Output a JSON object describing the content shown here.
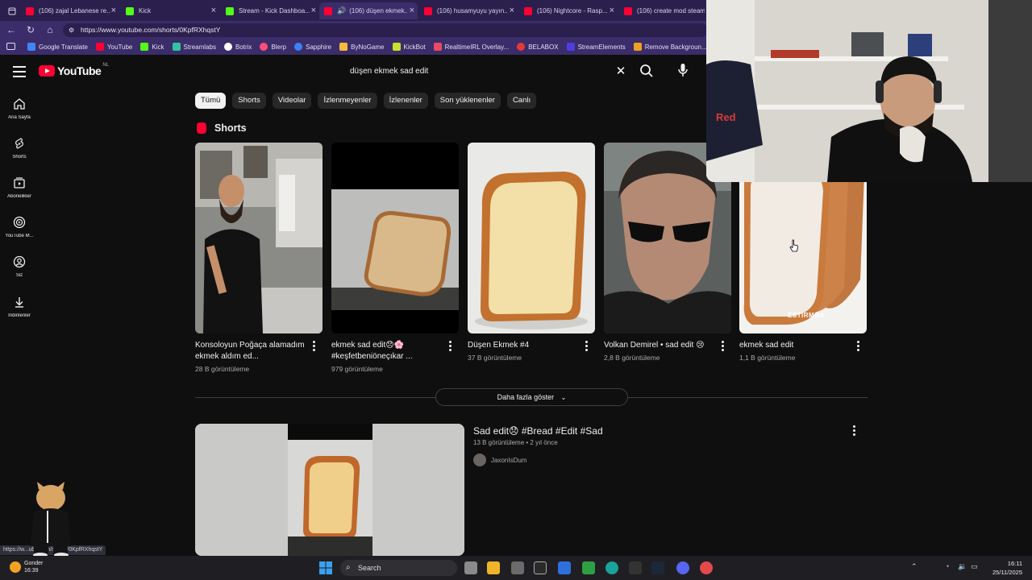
{
  "browser": {
    "tabs": [
      {
        "label": "(106) zajal Lebanese re...",
        "favicon": "youtube",
        "active": false
      },
      {
        "label": "Kick",
        "favicon": "kick",
        "active": false
      },
      {
        "label": "Stream - Kick Dashboa...",
        "favicon": "kick",
        "active": false
      },
      {
        "label": "(106) düşen ekmek...",
        "favicon": "youtube",
        "active": true
      },
      {
        "label": "(106) husamyuyu yayın...",
        "favicon": "youtube",
        "active": false
      },
      {
        "label": "(106) Nightcore - Rasp...",
        "favicon": "youtube",
        "active": false
      },
      {
        "label": "(106) create mod steam...",
        "favicon": "youtube",
        "active": false
      }
    ],
    "url": "https://www.youtube.com/shorts/0KpfRXhqstY",
    "bookmarks": [
      {
        "label": "Google Translate",
        "color": "#4285f4"
      },
      {
        "label": "YouTube",
        "color": "#ff0033"
      },
      {
        "label": "Kick",
        "color": "#53fc18"
      },
      {
        "label": "Streamlabs",
        "color": "#31c3a2"
      },
      {
        "label": "Botrix",
        "color": "#ffffff"
      },
      {
        "label": "Blerp",
        "color": "#ff4d7a"
      },
      {
        "label": "Sapphire",
        "color": "#3b82f6"
      },
      {
        "label": "ByNoGame",
        "color": "#f6b93b"
      },
      {
        "label": "KickBot",
        "color": "#c6e02b"
      },
      {
        "label": "RealtimeIRL Overlay...",
        "color": "#e84a5f"
      },
      {
        "label": "BELABOX",
        "color": "#e53935"
      },
      {
        "label": "StreamElements",
        "color": "#4d3ee0"
      },
      {
        "label": "Remove Backgroun...",
        "color": "#f0a020"
      }
    ]
  },
  "youtube": {
    "logo_text": "YouTube",
    "country_code": "NL",
    "search_query": "düşen ekmek sad edit",
    "guide": [
      {
        "label": "Ana Sayfa",
        "icon": "home-icon"
      },
      {
        "label": "Shorts",
        "icon": "shorts-icon"
      },
      {
        "label": "Abonelikler",
        "icon": "subscriptions-icon"
      },
      {
        "label": "YouTube M...",
        "icon": "youtube-music-icon"
      },
      {
        "label": "Siz",
        "icon": "you-icon"
      },
      {
        "label": "İndirilenler",
        "icon": "downloads-icon"
      }
    ],
    "chips": [
      {
        "label": "Tümü",
        "selected": true
      },
      {
        "label": "Shorts",
        "selected": false
      },
      {
        "label": "Videolar",
        "selected": false
      },
      {
        "label": "İzlenmeyenler",
        "selected": false
      },
      {
        "label": "İzlenenler",
        "selected": false
      },
      {
        "label": "Son yüklenenler",
        "selected": false
      },
      {
        "label": "Canlı",
        "selected": false
      }
    ],
    "shorts_heading": "Shorts",
    "shorts": [
      {
        "title": "Konsoloyun Poğaça alamadım ekmek aldım ed...",
        "views": "28 B görüntüleme"
      },
      {
        "title": "ekmek sad edit😞🌸 #keşfetbeniöneçıkar ...",
        "views": "979 görüntüleme"
      },
      {
        "title": "Düşen Ekmek #4",
        "views": "37 B görüntüleme"
      },
      {
        "title": "Volkan Demirel • sad edit 😢",
        "views": "2,8 B görüntüleme"
      },
      {
        "title": "ekmek sad edit",
        "views": "1,1 B görüntüleme",
        "watermark": "ESTIRMBA"
      }
    ],
    "show_more": "Daha fazla göster",
    "video": {
      "title": "Sad edit😞 #Bread #Edit #Sad",
      "views": "13 B görüntüleme",
      "age": "2 yıl önce",
      "channel": "JaxonIsDum"
    }
  },
  "status_url": "https://w...ube.com/shorts/0KpfRXhqstY",
  "taskbar": {
    "search_placeholder": "Search",
    "time": "16:11",
    "date": "25/11/2025",
    "weather_temp": "16:39",
    "weather_label": "Gonder"
  }
}
